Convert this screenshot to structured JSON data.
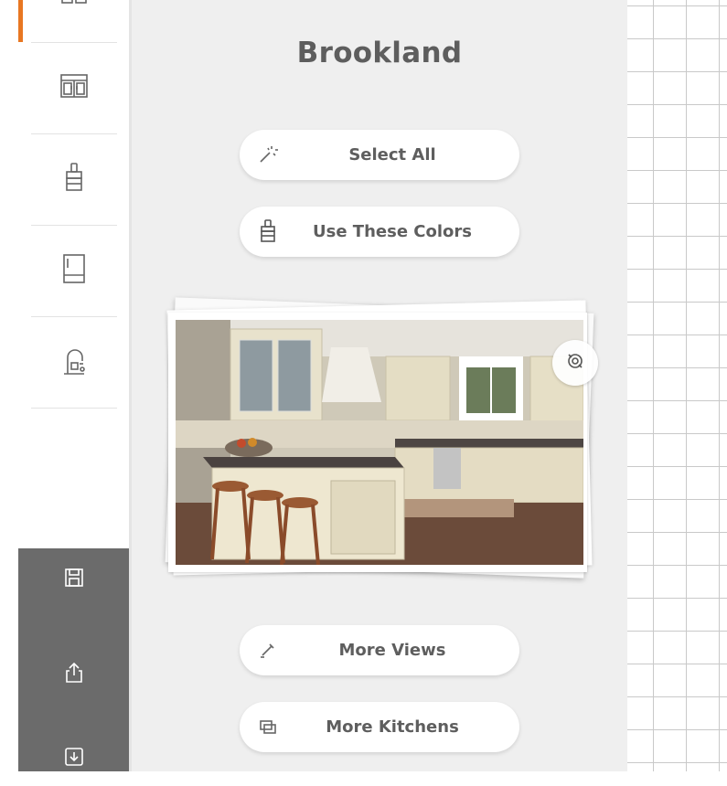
{
  "panel": {
    "title": "Brookland",
    "buttons": {
      "select_all": "Select All",
      "use_colors": "Use These Colors",
      "more_views": "More Views",
      "more_kitchens": "More Kitchens"
    }
  },
  "sidebar": {
    "items": [
      {
        "icon": "layout-icon"
      },
      {
        "icon": "cabinet-icon"
      },
      {
        "icon": "paintbrush-icon"
      },
      {
        "icon": "refrigerator-icon"
      },
      {
        "icon": "faucet-icon"
      }
    ],
    "actions": [
      {
        "icon": "save-icon"
      },
      {
        "icon": "share-icon"
      },
      {
        "icon": "download-icon"
      }
    ]
  },
  "colors": {
    "accent": "#e87722",
    "panel_bg": "#efefef",
    "sidebar_dark": "#6b6b6b",
    "text": "#5e5e5e"
  },
  "photo": {
    "subject": "kitchen"
  }
}
